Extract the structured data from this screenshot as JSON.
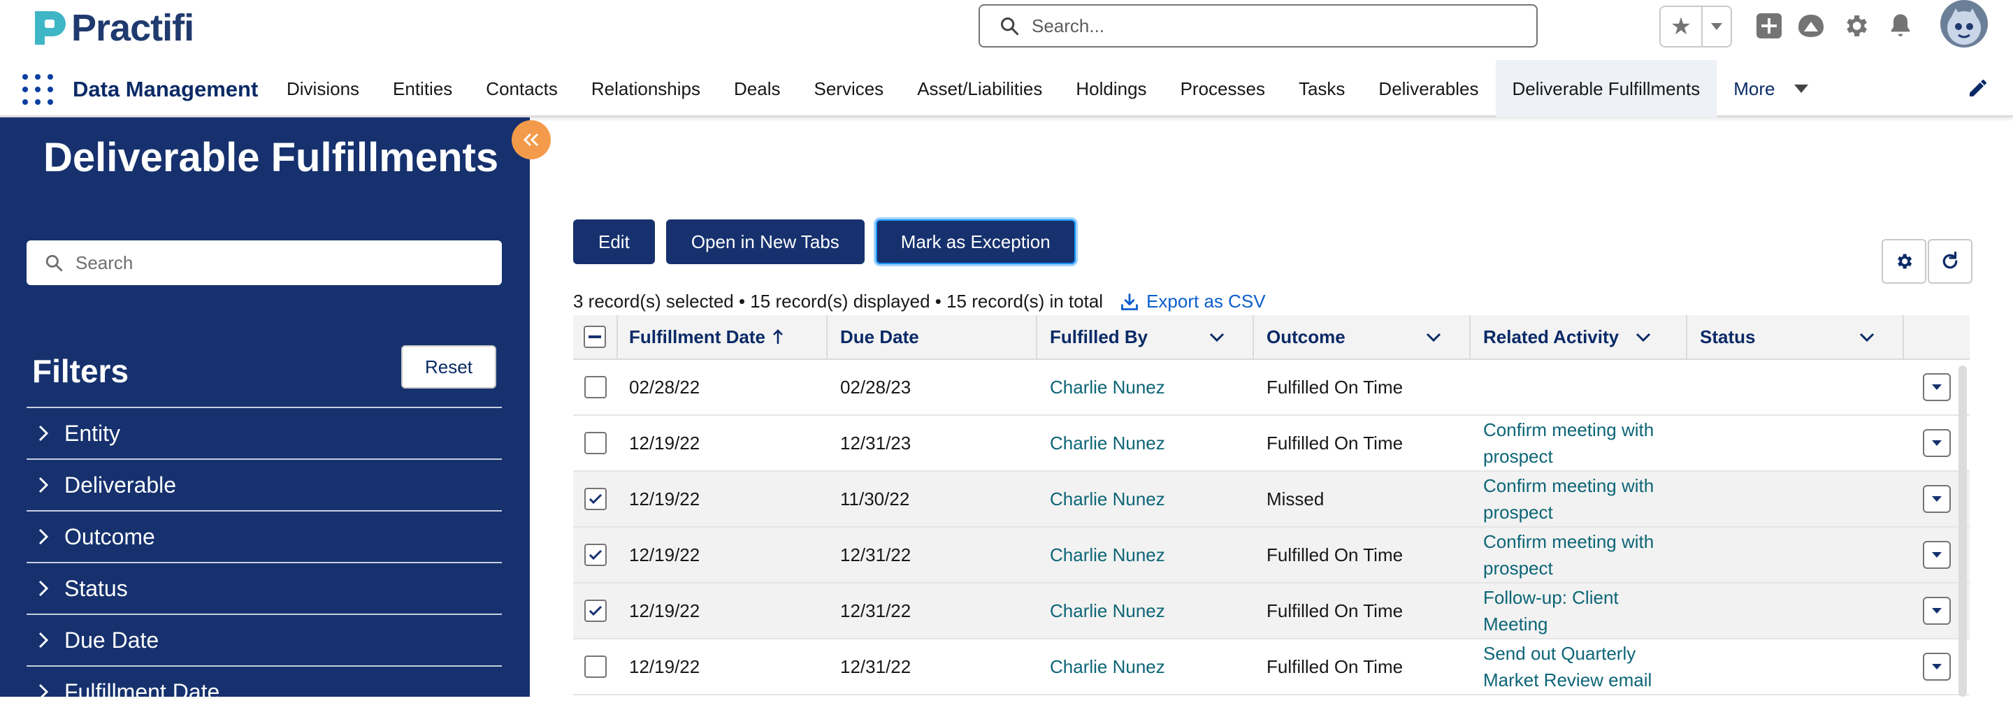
{
  "app": {
    "logo_text": "Practifi",
    "search_placeholder": "Search...",
    "name": "Data Management"
  },
  "colors": {
    "brand_navy": "#16316e",
    "accent_orange": "#f39b4a",
    "link_teal": "#0d6577",
    "link_blue": "#0b5ecc"
  },
  "nav": {
    "items": [
      {
        "label": "Divisions"
      },
      {
        "label": "Entities"
      },
      {
        "label": "Contacts"
      },
      {
        "label": "Relationships"
      },
      {
        "label": "Deals"
      },
      {
        "label": "Services"
      },
      {
        "label": "Asset/Liabilities"
      },
      {
        "label": "Holdings"
      },
      {
        "label": "Processes"
      },
      {
        "label": "Tasks"
      },
      {
        "label": "Deliverables"
      },
      {
        "label": "Deliverable Fulfillments"
      }
    ],
    "more_label": "More"
  },
  "sidebar": {
    "title": "Deliverable Fulfillments",
    "search_placeholder": "Search",
    "filters_title": "Filters",
    "reset_label": "Reset",
    "filters": [
      {
        "label": "Entity"
      },
      {
        "label": "Deliverable"
      },
      {
        "label": "Outcome"
      },
      {
        "label": "Status"
      },
      {
        "label": "Due Date"
      },
      {
        "label": "Fulfillment Date"
      }
    ]
  },
  "toolbar": {
    "edit_label": "Edit",
    "open_tabs_label": "Open in New Tabs",
    "mark_exception_label": "Mark as Exception"
  },
  "records": {
    "summary": "3 record(s) selected • 15 record(s) displayed • 15 record(s) in total",
    "export_label": "Export as CSV"
  },
  "table": {
    "columns": {
      "fulfillment_date": "Fulfillment Date",
      "due_date": "Due Date",
      "fulfilled_by": "Fulfilled By",
      "outcome": "Outcome",
      "related_activity": "Related Activity",
      "status": "Status"
    },
    "rows": [
      {
        "checked": false,
        "fulfillment_date": "02/28/22",
        "due_date": "02/28/23",
        "fulfilled_by": "Charlie Nunez",
        "outcome": "Fulfilled On Time",
        "related_activity": "",
        "status": ""
      },
      {
        "checked": false,
        "fulfillment_date": "12/19/22",
        "due_date": "12/31/23",
        "fulfilled_by": "Charlie Nunez",
        "outcome": "Fulfilled On Time",
        "related_activity": "Confirm meeting with prospect",
        "status": ""
      },
      {
        "checked": true,
        "fulfillment_date": "12/19/22",
        "due_date": "11/30/22",
        "fulfilled_by": "Charlie Nunez",
        "outcome": "Missed",
        "related_activity": "Confirm meeting with prospect",
        "status": ""
      },
      {
        "checked": true,
        "fulfillment_date": "12/19/22",
        "due_date": "12/31/22",
        "fulfilled_by": "Charlie Nunez",
        "outcome": "Fulfilled On Time",
        "related_activity": "Confirm meeting with prospect",
        "status": ""
      },
      {
        "checked": true,
        "fulfillment_date": "12/19/22",
        "due_date": "12/31/22",
        "fulfilled_by": "Charlie Nunez",
        "outcome": "Fulfilled On Time",
        "related_activity": "Follow-up: Client Meeting",
        "status": ""
      },
      {
        "checked": false,
        "fulfillment_date": "12/19/22",
        "due_date": "12/31/22",
        "fulfilled_by": "Charlie Nunez",
        "outcome": "Fulfilled On Time",
        "related_activity": "Send out Quarterly Market Review email",
        "status": ""
      }
    ]
  }
}
